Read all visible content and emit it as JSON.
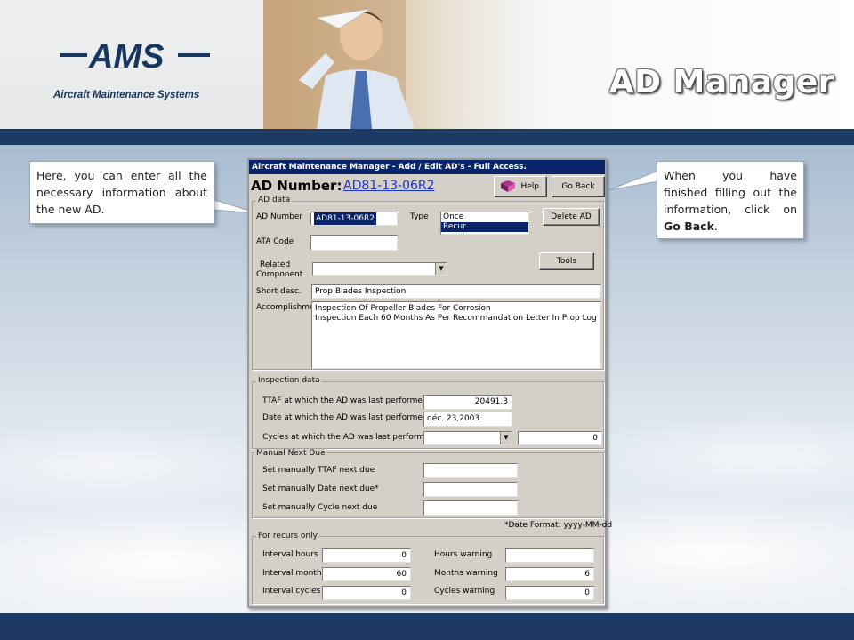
{
  "slide": {
    "brand": "AMS",
    "brand_subtitle": "Aircraft Maintenance Systems",
    "title": "AD Manager"
  },
  "callouts": {
    "left": "Here, you can enter all the necessary information about the new AD.",
    "right_prefix": "When you have finished filling out the information, click on",
    "right_bold": "Go Back",
    "right_suffix": "."
  },
  "dialog": {
    "title": "Aircraft Maintenance Manager - Add / Edit AD's - Full Access.",
    "heading": "AD Number:",
    "ad_link": "AD81-13-06R2",
    "buttons": {
      "help": "Help",
      "go_back": "Go Back",
      "delete_ad": "Delete AD",
      "tools": "Tools"
    },
    "ad_data": {
      "group_label": "AD data",
      "ad_number_label": "AD Number",
      "ad_number_value": "AD81-13-06R2",
      "type_label": "Type",
      "type_options": [
        "Once",
        "Recur"
      ],
      "type_selected": "Recur",
      "ata_code_label": "ATA Code",
      "ata_code_value": "",
      "related_component_label_1": "Related",
      "related_component_label_2": "Component",
      "related_component_value": "",
      "short_desc_label": "Short desc.",
      "short_desc_value": "Prop Blades Inspection",
      "accomplishment_label": "Accomplishment",
      "accomplishment_lines": [
        "Inspection Of Propeller Blades For Corrosion",
        "Inspection Each 60 Months As Per Recommandation Letter In Prop Log"
      ]
    },
    "inspection_data": {
      "group_label": "Inspection data",
      "ttaf_label": "TTAF at which the AD was last performed",
      "ttaf_value": "20491.3",
      "date_label": "Date at which the AD was last performed*",
      "date_value": "déc. 23,2003",
      "cycles_label": "Cycles at which the AD was last performed",
      "cycles_combo_value": "",
      "cycles_value": "0"
    },
    "manual_next_due": {
      "group_label": "Manual Next Due",
      "ttaf_label": "Set manually TTAF next due",
      "date_label": "Set manually Date next due*",
      "cycle_label": "Set manually Cycle next due",
      "ttaf_value": "",
      "date_value": "",
      "cycle_value": ""
    },
    "date_format_note": "*Date Format: yyyy-MM-dd",
    "recurs": {
      "group_label": "For recurs only",
      "interval_hours_label": "Interval hours",
      "interval_hours_value": "0",
      "interval_months_label": "Interval months",
      "interval_months_value": "60",
      "interval_cycles_label": "Interval cycles",
      "interval_cycles_value": "0",
      "hours_warning_label": "Hours warning",
      "hours_warning_value": "",
      "months_warning_label": "Months warning",
      "months_warning_value": "6",
      "cycles_warning_label": "Cycles warning",
      "cycles_warning_value": "0"
    }
  },
  "colors": {
    "navy_band": "#1c3a64",
    "titlebar": "#0a246a",
    "link": "#1a33cc",
    "dialog_face": "#d4d0c8"
  }
}
